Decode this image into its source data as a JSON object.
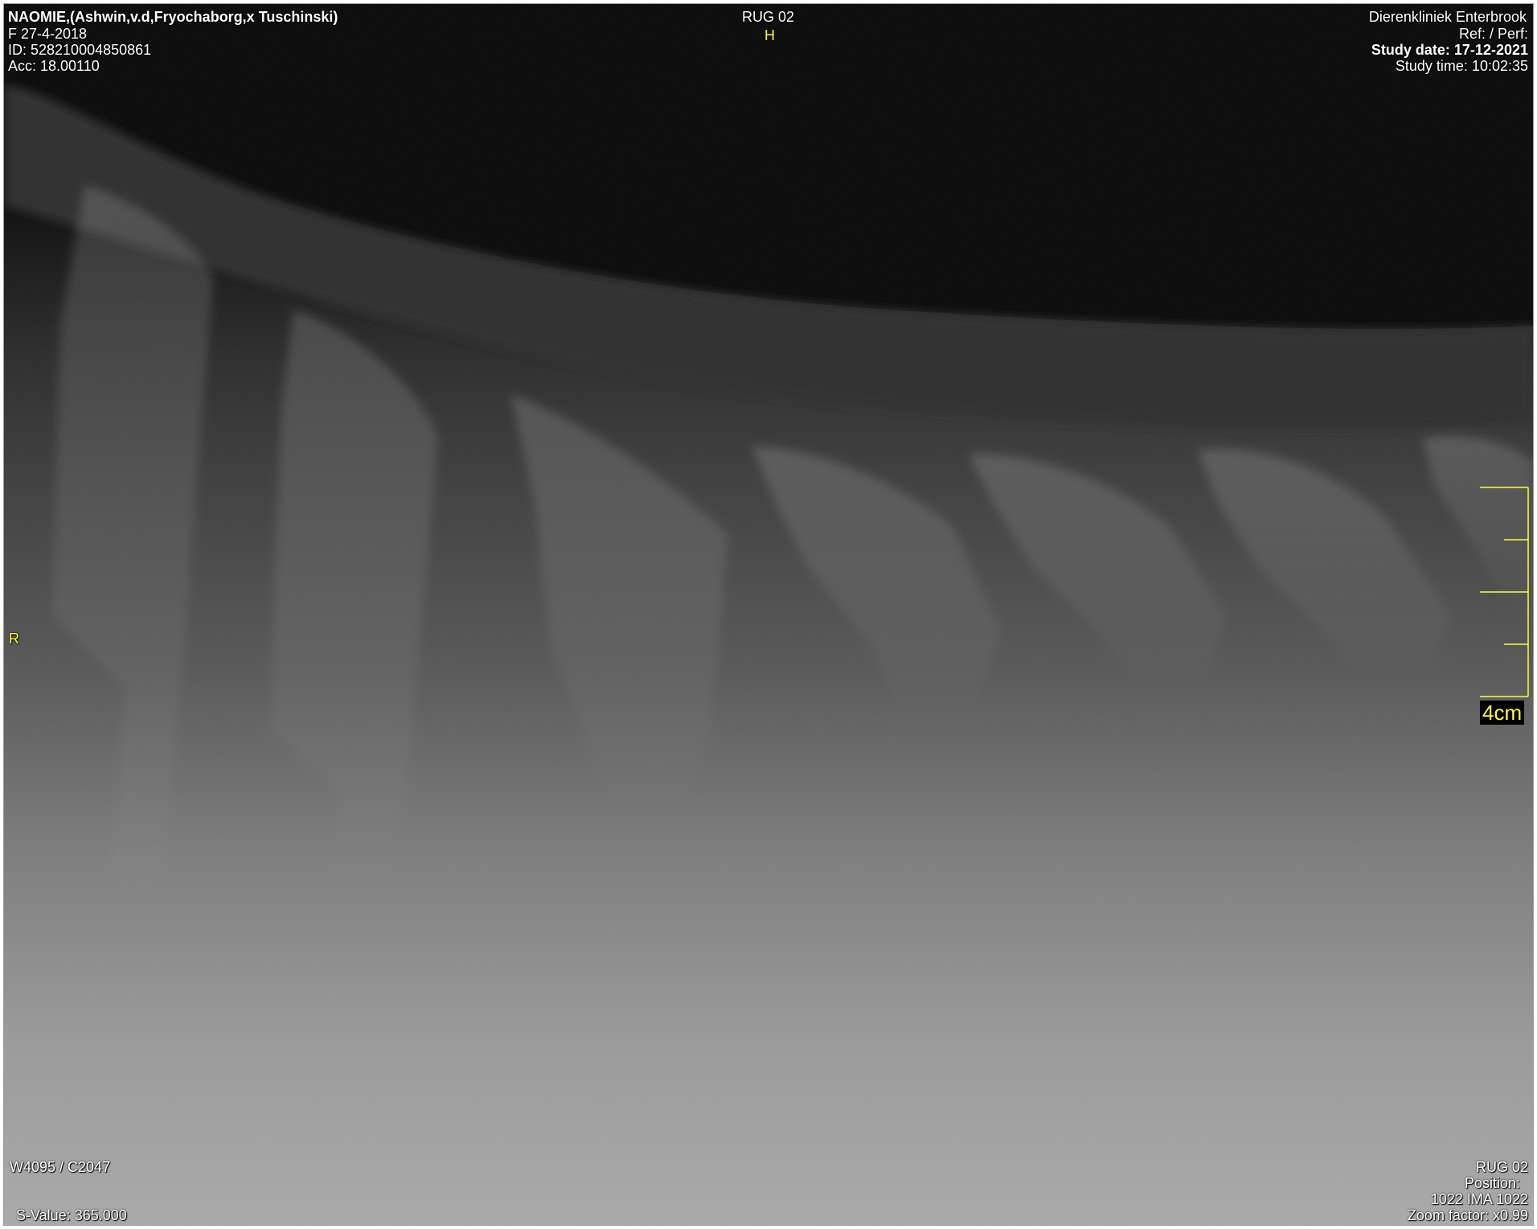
{
  "patient": {
    "name": "NAOMIE,(Ashwin,v.d,Fryochaborg,x Tuschinski)",
    "sex_dob": "F  27-4-2018",
    "id": "ID: 528210004850861",
    "acc": "Acc: 18.00110"
  },
  "series": {
    "title": "RUG 02",
    "orientation_top": "H",
    "orientation_left": "R"
  },
  "institution": {
    "name": "Dierenkliniek Enterbrook",
    "ref_perf": "Ref:  / Perf:",
    "study_date": "Study date: 17-12-2021",
    "study_time": "Study time: 10:02:35"
  },
  "scale": {
    "label": "4cm"
  },
  "window": {
    "level": "W4095 / C2047",
    "s_value": "S-Value: 365.000"
  },
  "image_info": {
    "series": "RUG 02",
    "position": "Position:",
    "ima": "1022 IMA 1022",
    "zoom": "Zoom factor: x0.99"
  },
  "colors": {
    "overlay_text": "#ffffff",
    "annotation": "#ffff33",
    "border": "#9a9a9a"
  }
}
